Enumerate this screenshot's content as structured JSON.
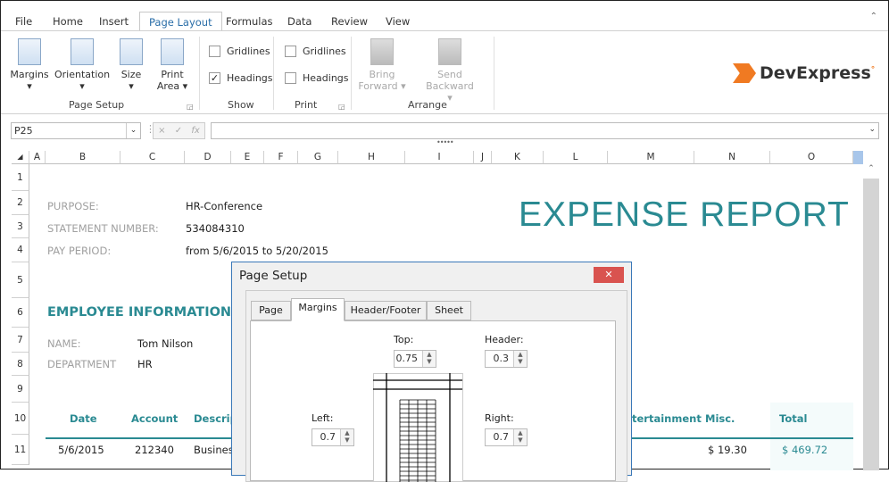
{
  "tabs": [
    {
      "label": "File"
    },
    {
      "label": "Home"
    },
    {
      "label": "Insert"
    },
    {
      "label": "Page Layout",
      "active": true
    },
    {
      "label": "Formulas"
    },
    {
      "label": "Data"
    },
    {
      "label": "Review"
    },
    {
      "label": "View"
    }
  ],
  "ribbon": {
    "page_setup": {
      "margins": "Margins",
      "orientation": "Orientation",
      "size": "Size",
      "print_area_1": "Print",
      "print_area_2": "Area",
      "group": "Page Setup"
    },
    "show": {
      "gridlines": "Gridlines",
      "gridlines_checked": false,
      "headings": "Headings",
      "headings_checked": true,
      "group": "Show"
    },
    "print": {
      "gridlines": "Gridlines",
      "gridlines_checked": false,
      "headings": "Headings",
      "headings_checked": false,
      "group": "Print"
    },
    "arrange": {
      "bring_1": "Bring",
      "bring_2": "Forward",
      "send": "Send Backward",
      "group": "Arrange"
    },
    "logo": "DevExpress"
  },
  "formula_bar": {
    "name_box": "P25",
    "cancel": "×",
    "enter": "✓",
    "fx": "fx",
    "formula": ""
  },
  "columns": [
    "A",
    "B",
    "C",
    "D",
    "E",
    "F",
    "G",
    "H",
    "I",
    "J",
    "K",
    "L",
    "M",
    "N",
    "O"
  ],
  "rows": [
    "1",
    "2",
    "3",
    "4",
    "5",
    "6",
    "7",
    "8",
    "9",
    "10",
    "11"
  ],
  "sheet": {
    "purpose_label": "PURPOSE:",
    "purpose": "HR-Conference",
    "statement_label": "STATEMENT NUMBER:",
    "statement": "534084310",
    "period_label": "PAY PERIOD:",
    "period": "from 5/6/2015 to 5/20/2015",
    "title": "EXPENSE REPORT",
    "employee_heading": "EMPLOYEE INFORMATION:",
    "name_label": "NAME:",
    "name": "Tom Nilson",
    "dept_label": "DEPARTMENT",
    "dept": "HR",
    "table_headers": {
      "date": "Date",
      "account": "Account",
      "description": "Descrip",
      "entertainment": "tertainment",
      "misc": "Misc.",
      "total": "Total"
    },
    "row": {
      "date": "5/6/2015",
      "account": "212340",
      "description": "Busines",
      "misc": "$ 19.30",
      "total": "$ 469.72"
    }
  },
  "dialog": {
    "title": "Page Setup",
    "close": "✕",
    "tabs": [
      "Page",
      "Margins",
      "Header/Footer",
      "Sheet"
    ],
    "active_tab": "Margins",
    "top_label": "Top:",
    "top": "0.75",
    "header_label": "Header:",
    "header": "0.3",
    "left_label": "Left:",
    "left": "0.7",
    "right_label": "Right:",
    "right": "0.7"
  },
  "colors": {
    "accent": "#2a8a92",
    "ribbon_active": "#2a6ea8",
    "close": "#d9534f"
  }
}
